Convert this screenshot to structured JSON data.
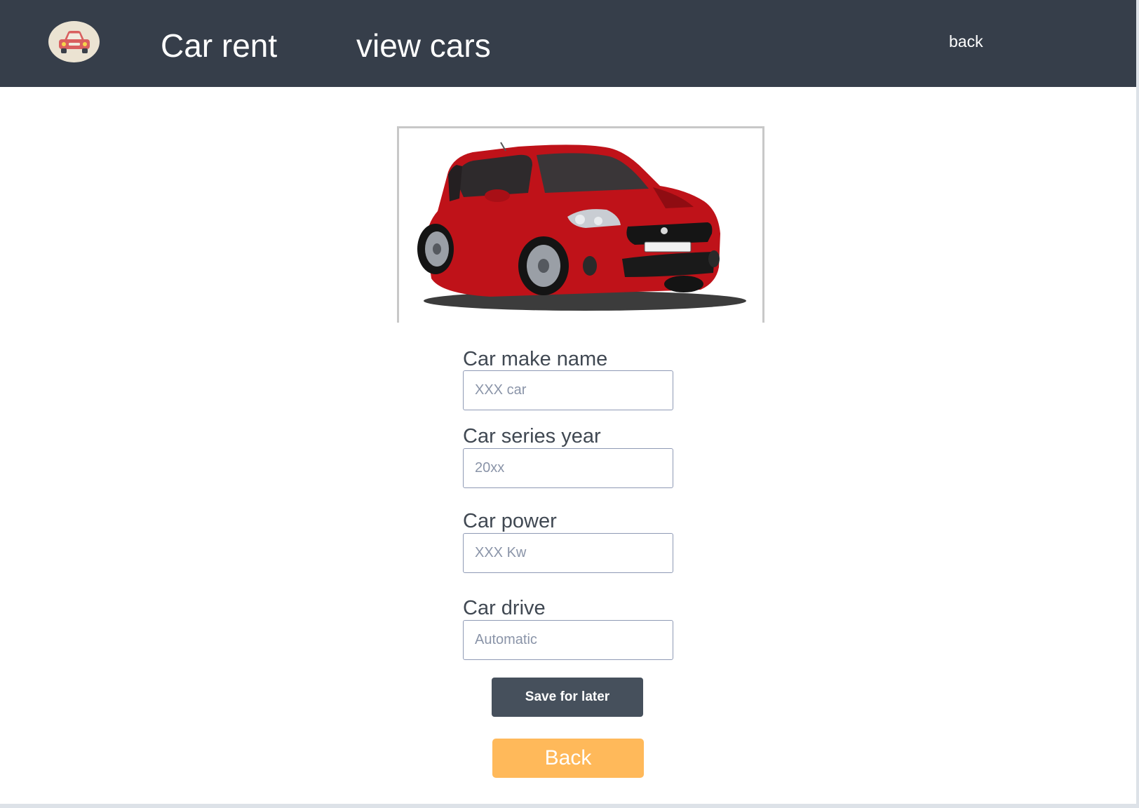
{
  "header": {
    "brand": "Car rent",
    "nav_view_cars": "view cars",
    "back_link": "back"
  },
  "form": {
    "make": {
      "label": "Car make name",
      "placeholder": "XXX car"
    },
    "year": {
      "label": "Car series year",
      "placeholder": "20xx"
    },
    "power": {
      "label": "Car power",
      "placeholder": "XXX Kw"
    },
    "drive": {
      "label": "Car drive",
      "placeholder": "Automatic"
    }
  },
  "buttons": {
    "save": "Save for later",
    "back": "Back"
  },
  "icons": {
    "logo": "car-icon"
  },
  "colors": {
    "header_bg": "#363e4a",
    "save_button": "#46505c",
    "back_button": "#ffb95a",
    "car_body": "#c8141c"
  }
}
